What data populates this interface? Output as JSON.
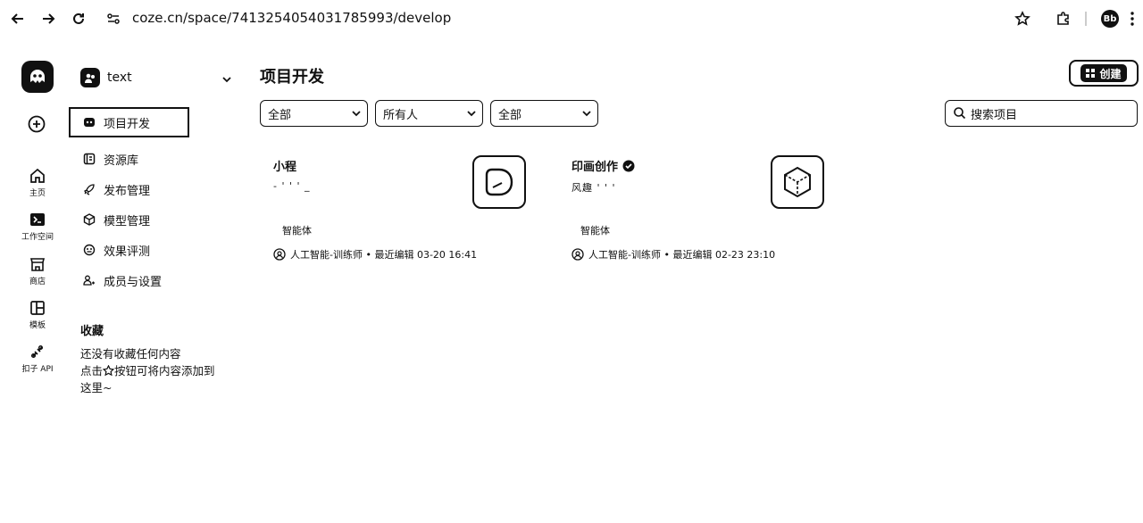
{
  "browser": {
    "url": "coze.cn/space/7413254054031785993/develop",
    "avatar_initials": "Bb"
  },
  "rail": {
    "items": [
      {
        "label": "主页",
        "icon": "home-icon"
      },
      {
        "label": "工作空间",
        "icon": "workspace-icon"
      },
      {
        "label": "商店",
        "icon": "store-icon"
      },
      {
        "label": "模板",
        "icon": "template-icon"
      },
      {
        "label": "扣子 API",
        "icon": "api-icon"
      }
    ]
  },
  "sidebar": {
    "team_name": "text",
    "menu": [
      {
        "label": "项目开发",
        "icon": "project-icon",
        "active": true
      },
      {
        "label": "资源库",
        "icon": "library-icon"
      },
      {
        "label": "发布管理",
        "icon": "rocket-icon"
      },
      {
        "label": "模型管理",
        "icon": "model-icon"
      },
      {
        "label": "效果评测",
        "icon": "evaluation-icon"
      },
      {
        "label": "成员与设置",
        "icon": "members-icon"
      }
    ],
    "favorites_title": "收藏",
    "favorites_empty_1": "还没有收藏任何内容",
    "favorites_empty_2_a": "点击",
    "favorites_empty_2_b": "按钮可将内容添加到",
    "favorites_empty_3": "这里~"
  },
  "main": {
    "title": "项目开发",
    "create_label": "创建",
    "filters": [
      "全部",
      "所有人",
      "全部"
    ],
    "search_placeholder": "搜索项目",
    "cards": [
      {
        "name": "小程",
        "desc": "- ' ' ' _",
        "type": "智能体",
        "meta": "人工智能-训练师 • 最近编辑 03-20 16:41"
      },
      {
        "name": "印画创作",
        "desc": "风趣 ' ' '",
        "type": "智能体",
        "meta": "人工智能-训练师 • 最近编辑 02-23 23:10"
      }
    ]
  },
  "colors": {
    "ink": "#111111",
    "background": "#ffffff"
  }
}
